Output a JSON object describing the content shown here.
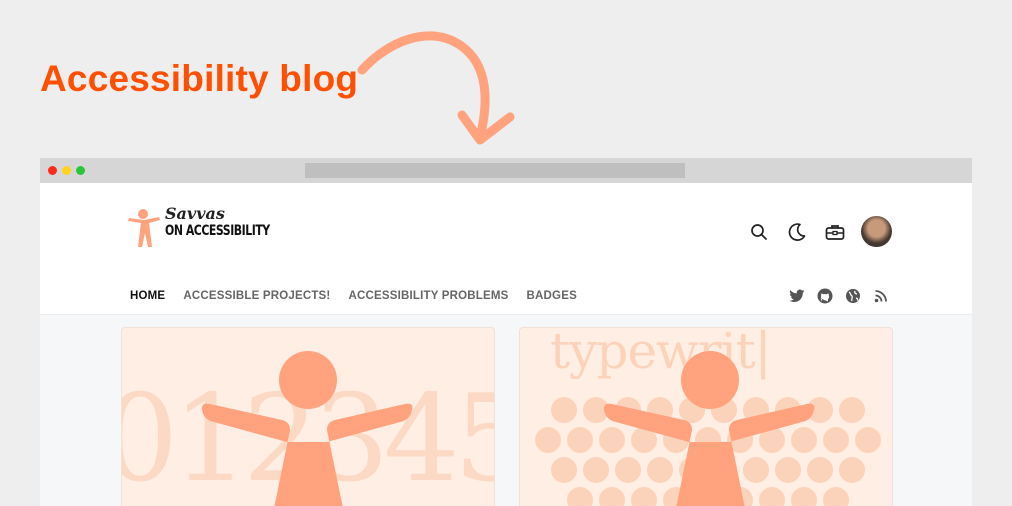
{
  "promo": {
    "title": "Accessibility blog"
  },
  "colors": {
    "accent": "#ff4f00",
    "figure": "#ffa27d",
    "card_bg": "#ffeee3"
  },
  "browser": {
    "window_controls": [
      "close",
      "minimize",
      "maximize"
    ],
    "address": ""
  },
  "site": {
    "logo": {
      "line1": "Savvas",
      "line2": "ON ACCESSIBILITY"
    },
    "tools": [
      "search-icon",
      "moon-icon",
      "toolbox-icon",
      "avatar"
    ],
    "nav": [
      {
        "label": "HOME",
        "active": true
      },
      {
        "label": "ACCESSIBLE PROJECTS!",
        "active": false
      },
      {
        "label": "ACCESSIBILITY PROBLEMS",
        "active": false
      },
      {
        "label": "BADGES",
        "active": false
      }
    ],
    "social": [
      "twitter-icon",
      "github-icon",
      "globe-icon",
      "rss-icon"
    ]
  },
  "cards": [
    {
      "background_text": "012345"
    },
    {
      "background_text": "typewrit|"
    }
  ]
}
